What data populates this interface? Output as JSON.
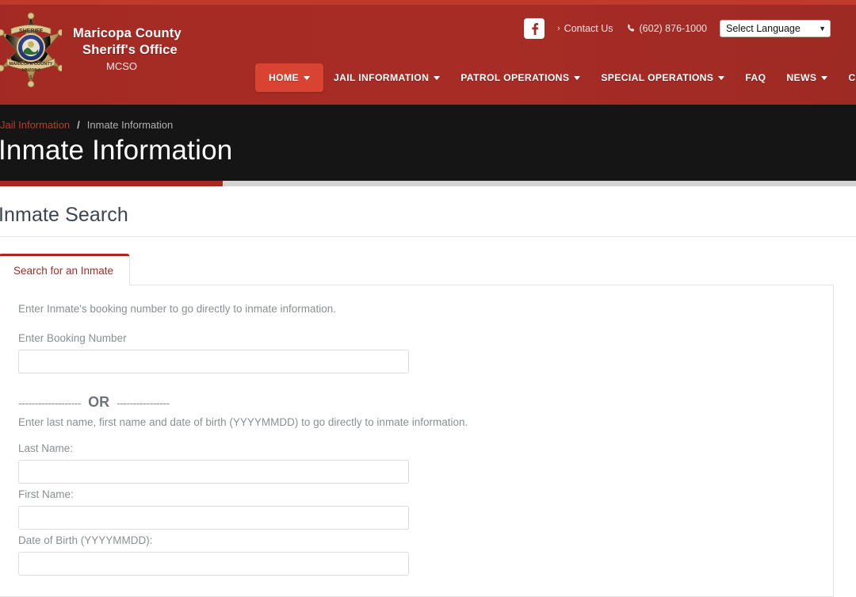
{
  "header": {
    "brand": {
      "line1": "Maricopa County",
      "line2": "Sheriff's Office",
      "line3": "MCSO",
      "badge_text": {
        "top": "SHERIFF",
        "ribbon": "MARICOPA COUNTY",
        "state": "ARIZONA",
        "number": "1"
      }
    },
    "utility": {
      "facebook_label": "f",
      "contact_chevron": "›",
      "contact_label": "Contact Us",
      "phone_icon": "☎",
      "phone": "(602) 876-1000",
      "language_label": "Select Language",
      "language_caret": "▼"
    },
    "nav": [
      {
        "label": "HOME",
        "has_caret": true,
        "active": true
      },
      {
        "label": "JAIL INFORMATION",
        "has_caret": true,
        "active": false
      },
      {
        "label": "PATROL OPERATIONS",
        "has_caret": true,
        "active": false
      },
      {
        "label": "SPECIAL OPERATIONS",
        "has_caret": true,
        "active": false
      },
      {
        "label": "FAQ",
        "has_caret": false,
        "active": false
      },
      {
        "label": "NEWS",
        "has_caret": true,
        "active": false
      },
      {
        "label": "CAREERS",
        "has_caret": true,
        "active": false
      }
    ]
  },
  "banner": {
    "breadcrumb_parent": "Jail Information",
    "breadcrumb_separator": "/",
    "breadcrumb_current": "Inmate Information",
    "title": "Inmate Information",
    "progress_percent": 28
  },
  "main": {
    "section_title": "Inmate Search",
    "tab_label": "Search for an Inmate",
    "lead_text": "Enter Inmate's booking number to go directly to inmate information.",
    "booking_label": "Enter Booking Number",
    "booking_value": "",
    "booking_placeholder": "",
    "or_dashes_left": "-------------------",
    "or_word": "OR",
    "or_dashes_right": "----------------",
    "name_lead_text": "Enter last name, first name and date of birth (YYYYMMDD) to go directly to inmate information.",
    "last_name_label": "Last Name:",
    "last_name_value": "",
    "first_name_label": "First Name:",
    "first_name_value": "",
    "dob_label": "Date of Birth (YYYYMMDD):",
    "dob_value": ""
  },
  "colors": {
    "brand_red": "#a32a24",
    "accent_red": "#c0392b",
    "active_nav": "#d94332",
    "banner_bg": "#151515",
    "tab_text": "#9b2d2a"
  }
}
